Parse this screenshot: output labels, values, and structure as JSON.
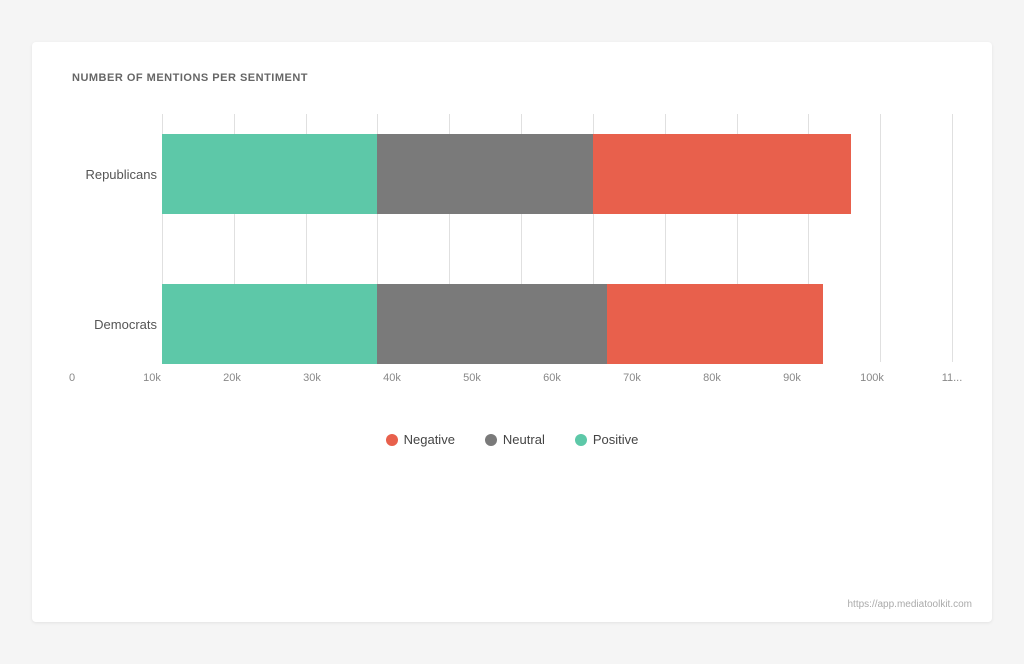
{
  "chart": {
    "title": "NUMBER OF MENTIONS PER SENTIMENT",
    "url": "https://app.mediatoolkit.com",
    "colors": {
      "negative": "#e8604c",
      "neutral": "#7a7a7a",
      "positive": "#5dc8a8"
    },
    "maxValue": 110000,
    "chartWidth": 800,
    "rows": [
      {
        "label": "Republicans",
        "positive": 30000,
        "neutral": 30000,
        "negative": 36000
      },
      {
        "label": "Democrats",
        "positive": 30000,
        "neutral": 32000,
        "negative": 30000
      }
    ],
    "xAxis": {
      "labels": [
        "0",
        "10k",
        "20k",
        "30k",
        "40k",
        "50k",
        "60k",
        "70k",
        "80k",
        "90k",
        "100k",
        "11..."
      ]
    },
    "legend": [
      {
        "key": "negative",
        "label": "Negative"
      },
      {
        "key": "neutral",
        "label": "Neutral"
      },
      {
        "key": "positive",
        "label": "Positive"
      }
    ]
  }
}
